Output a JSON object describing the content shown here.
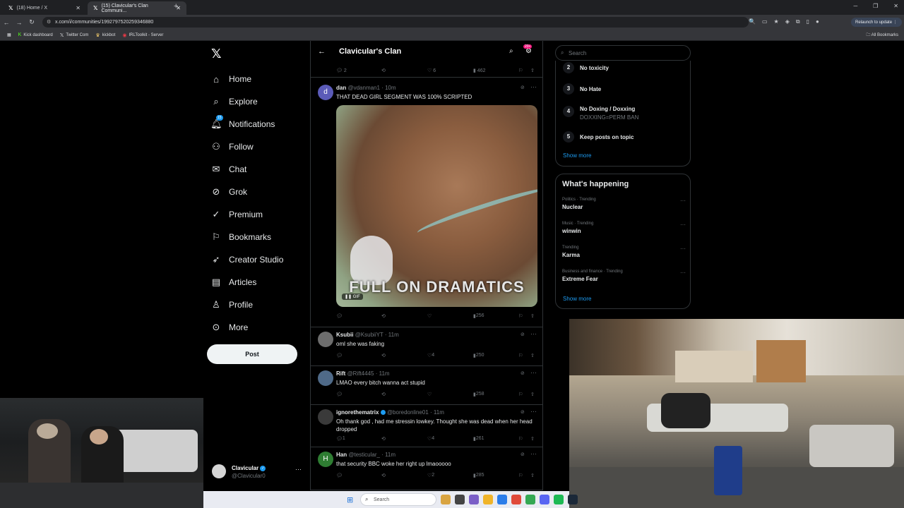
{
  "browser": {
    "tabs": [
      {
        "title": "(18) Home / X"
      },
      {
        "title": "(15) Clavicular's Clan Communi..."
      }
    ],
    "url": "x.com/i/communities/1992797520259346880",
    "relaunch_label": "Relaunch to update",
    "bookmarks": [
      "Kick dashboard",
      "Twitter Com",
      "kickbot",
      "IRLToolkit - Server"
    ],
    "all_bookmarks": "All Bookmarks"
  },
  "nav": {
    "items": [
      {
        "label": "Home",
        "icon": "home-icon"
      },
      {
        "label": "Explore",
        "icon": "search-icon"
      },
      {
        "label": "Notifications",
        "icon": "bell-icon",
        "badge": "15"
      },
      {
        "label": "Follow",
        "icon": "follow-icon"
      },
      {
        "label": "Chat",
        "icon": "mail-icon"
      },
      {
        "label": "Grok",
        "icon": "grok-icon"
      },
      {
        "label": "Premium",
        "icon": "premium-icon"
      },
      {
        "label": "Bookmarks",
        "icon": "bookmark-icon"
      },
      {
        "label": "Creator Studio",
        "icon": "rocket-icon"
      },
      {
        "label": "Articles",
        "icon": "article-icon"
      },
      {
        "label": "Profile",
        "icon": "profile-icon"
      },
      {
        "label": "More",
        "icon": "more-icon"
      }
    ],
    "post_label": "Post",
    "account": {
      "name": "Clavicular",
      "handle": "@Clavicular0"
    }
  },
  "feed": {
    "title": "Clavicular's Clan",
    "header_badge": "20+",
    "top_actions": {
      "replies": "2",
      "likes": "6",
      "views": "462"
    },
    "tweets": [
      {
        "name": "dan",
        "handle": "@vdanman1",
        "time": "10m",
        "avatar": "d",
        "text": "THAT DEAD GIRL SEGMENT WAS 100% SCRIPTED",
        "media_caption": "FULL ON DRAMATICS",
        "media_badge": "GIF",
        "replies": "",
        "likes": "",
        "views": "256"
      },
      {
        "name": "Ksubii",
        "handle": "@KsubiiYT",
        "time": "11m",
        "text": "oml she was faking",
        "replies": "",
        "likes": "4",
        "views": "250"
      },
      {
        "name": "Rift",
        "handle": "@Rift4445",
        "time": "11m",
        "text": "LMAO every bitch wanna act stupid",
        "replies": "",
        "likes": "",
        "views": "258"
      },
      {
        "name": "ignorethematrix",
        "handle": "@boredonline01",
        "time": "11m",
        "text": "Oh thank god , had me stressin lowkey. Thought she was dead when her head dropped",
        "replies": "1",
        "likes": "4",
        "views": "261"
      },
      {
        "name": "Han",
        "handle": "@testicular_",
        "time": "11m",
        "avatar": "H",
        "text": "that security BBC woke her right up lmaooooo",
        "replies": "",
        "likes": "2",
        "views": "285"
      }
    ]
  },
  "sidebar": {
    "search_placeholder": "Search",
    "rules": [
      {
        "num": "2",
        "title": "No toxicity",
        "desc": ""
      },
      {
        "num": "3",
        "title": "No Hate",
        "desc": ""
      },
      {
        "num": "4",
        "title": "No Doxing / Doxxing",
        "desc": "DOXXING=PERM BAN"
      },
      {
        "num": "5",
        "title": "Keep posts on topic",
        "desc": ""
      }
    ],
    "show_more": "Show more",
    "happening_title": "What's happening",
    "trends": [
      {
        "category": "Politics · Trending",
        "name": "Nuclear"
      },
      {
        "category": "Music · Trending",
        "name": "winwin"
      },
      {
        "category": "Trending",
        "name": "Karma"
      },
      {
        "category": "Business and finance · Trending",
        "name": "Extreme Fear"
      }
    ],
    "show_more_2": "Show more"
  },
  "taskbar": {
    "search_placeholder": "Search"
  }
}
